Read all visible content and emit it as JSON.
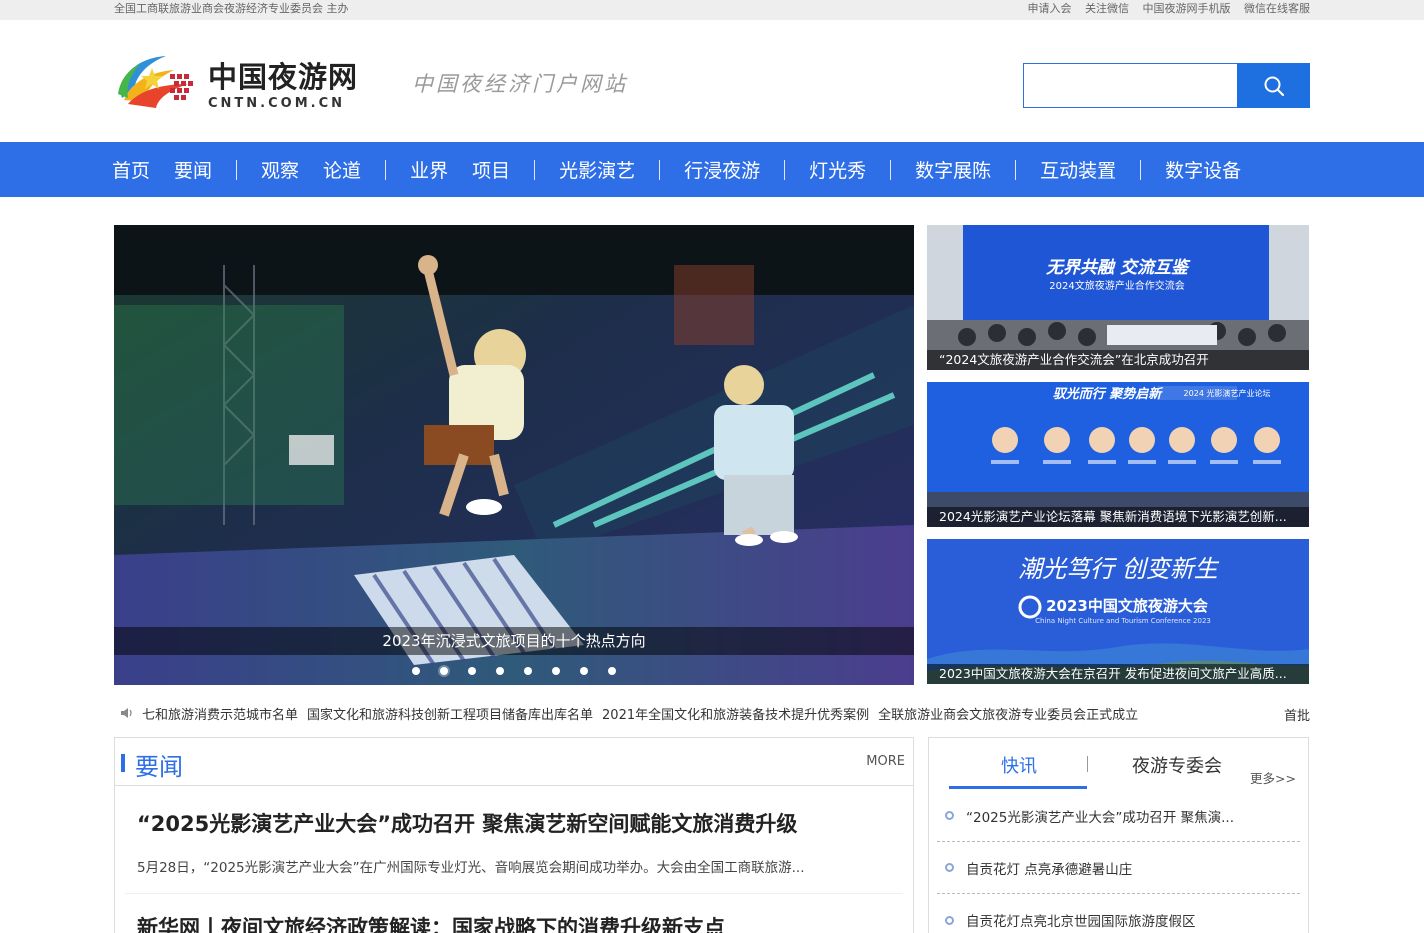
{
  "topbar": {
    "left": "全国工商联旅游业商会夜游经济专业委员会 主办",
    "links": [
      "申请入会",
      "关注微信",
      "中国夜游网手机版",
      "微信在线客服"
    ]
  },
  "header": {
    "logo_cn": "中国夜游网",
    "logo_en": "CNTN.COM.CN",
    "slogan": "中国夜经济门户网站",
    "search_placeholder": "",
    "search_icon": "search-icon"
  },
  "nav": {
    "groups": [
      [
        "首页",
        "要闻"
      ],
      [
        "观察",
        "论道"
      ],
      [
        "业界",
        "项目"
      ],
      [
        "光影演艺"
      ],
      [
        "行浸夜游"
      ],
      [
        "灯光秀"
      ],
      [
        "数字展陈"
      ],
      [
        "互动装置"
      ],
      [
        "数字设备"
      ]
    ]
  },
  "banner": {
    "main_caption": "2023年沉浸式文旅项目的十个热点方向",
    "dot_count": 8,
    "active_dot": 1,
    "side": [
      {
        "caption": "“2024文旅夜游产业合作交流会”在北京成功召开",
        "headline": "无界共融 交流互鉴",
        "sub": "2024文旅夜游产业合作交流会"
      },
      {
        "caption": "2024光影演艺产业论坛落幕 聚焦新消费语境下光影演艺创新...",
        "headline": "驭光而行 聚势启新",
        "sub": "2024 光影演艺产业论坛"
      },
      {
        "caption": "2023中国文旅夜游大会在京召开 发布促进夜间文旅产业高质...",
        "headline": "潮光笃行 创变新生",
        "sub": "2023中国文旅夜游大会",
        "sub_en": "China Night Culture and Tourism Conference 2023"
      }
    ]
  },
  "ticker": {
    "items": [
      "七和旅游消费示范城市名单",
      "国家文化和旅游科技创新工程项目储备库出库名单",
      "2021年全国文化和旅游装备技术提升优秀案例",
      "全联旅游业商会文旅夜游专业委员会正式成立"
    ],
    "home": "首批"
  },
  "news": {
    "title": "要闻",
    "more": "MORE",
    "items": [
      {
        "title": "“2025光影演艺产业大会”成功召开 聚焦演艺新空间赋能文旅消费升级",
        "summary": "5月28日，“2025光影演艺产业大会”在广州国际专业灯光、音响展览会期间成功举办。大会由全国工商联旅游..."
      },
      {
        "title": "新华网丨夜间文旅经济政策解读：国家战略下的消费升级新支点"
      }
    ]
  },
  "flash": {
    "tabs": [
      "快讯",
      "夜游专委会"
    ],
    "more": "更多>>",
    "items": [
      "“2025光影演艺产业大会”成功召开 聚焦演...",
      "自贡花灯 点亮承德避暑山庄",
      "自贡花灯点亮北京世园国际旅游度假区"
    ]
  }
}
